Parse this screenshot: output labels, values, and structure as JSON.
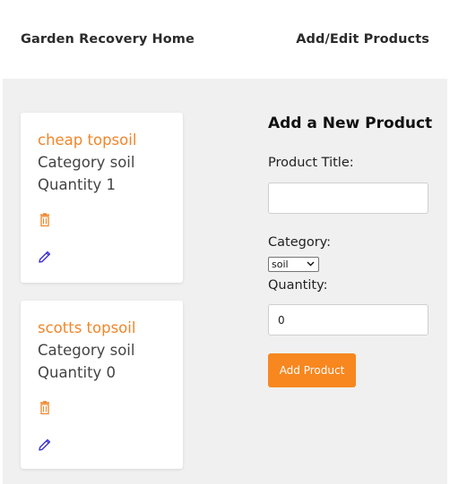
{
  "nav": {
    "home_label": "Garden Recovery Home",
    "edit_label": "Add/Edit Products"
  },
  "products": [
    {
      "title": "cheap topsoil",
      "category_text": "Category soil",
      "quantity_text": "Quantity 1",
      "delete_icon": "trash-icon",
      "edit_icon": "pencil-icon"
    },
    {
      "title": "scotts topsoil",
      "category_text": "Category soil",
      "quantity_text": "Quantity 0",
      "delete_icon": "trash-icon",
      "edit_icon": "pencil-icon"
    }
  ],
  "form": {
    "heading": "Add a New Product",
    "title_label": "Product Title:",
    "title_value": "",
    "category_label": "Category:",
    "category_selected": "soil",
    "quantity_label": "Quantity:",
    "quantity_value": "0",
    "submit_label": "Add Product"
  },
  "colors": {
    "accent": "#f7871e",
    "product_title": "#f0862a",
    "edit_icon": "#3b2fd6",
    "background": "#f0f0f0"
  }
}
